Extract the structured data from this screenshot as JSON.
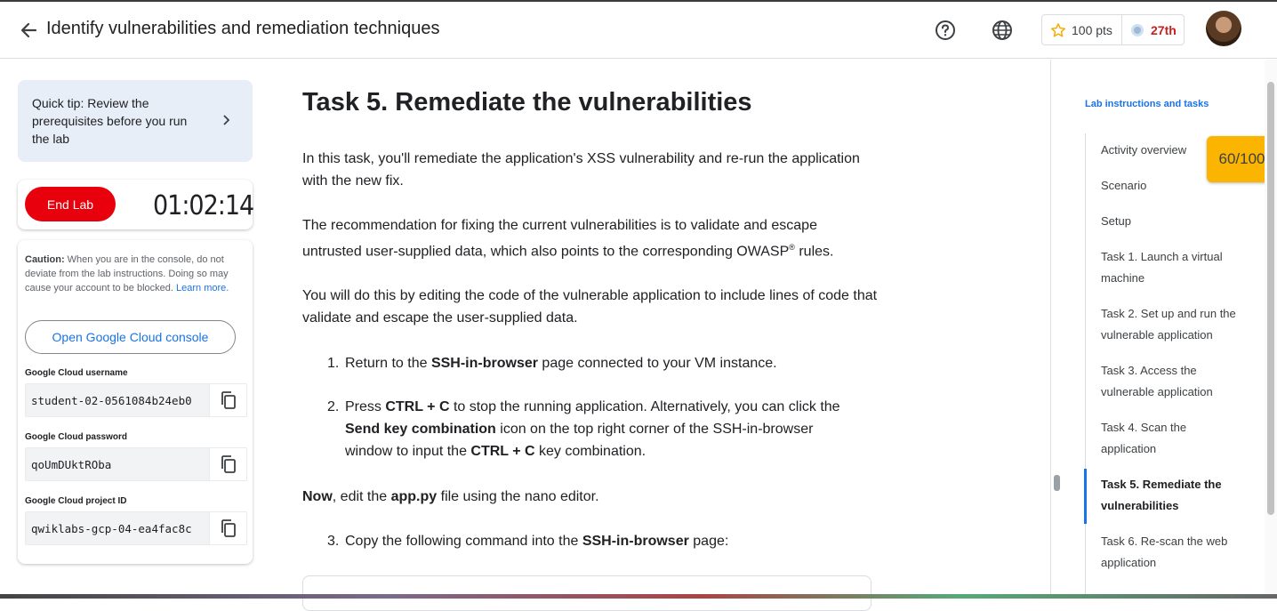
{
  "header": {
    "title": "Identify vulnerabilities and remediation techniques",
    "points": "100 pts",
    "rank": "27th"
  },
  "left": {
    "tip": "Quick tip: Review the prerequisites before you run the lab",
    "end_lab": "End Lab",
    "timer": "01:02:14",
    "caution_label": "Caution:",
    "caution_text": "When you are in the console, do not deviate from the lab instructions. Doing so may cause your account to be blocked.",
    "learn_more": "Learn more.",
    "console_button": "Open Google Cloud console",
    "credentials": [
      {
        "label": "Google Cloud username",
        "value": "student-02-0561084b24eb0"
      },
      {
        "label": "Google Cloud password",
        "value": "qoUmDUktROba"
      },
      {
        "label": "Google Cloud project ID",
        "value": "qwiklabs-gcp-04-ea4fac8c"
      }
    ]
  },
  "content": {
    "heading": "Task 5. Remediate the vulnerabilities",
    "p1": "In this task, you'll remediate the application's XSS vulnerability and re-run the application with the new fix.",
    "p2a": "The recommendation for fixing the current vulnerabilities is to validate and escape untrusted user-supplied data, which also points to the corresponding OWASP",
    "p2sup": "®",
    "p2b": " rules.",
    "p3": "You will do this by editing the code of the vulnerable application to include lines of code that validate and escape the user-supplied data.",
    "s1": {
      "num": "1.",
      "a": "Return to the ",
      "b": "SSH-in-browser",
      "c": " page connected to your VM instance."
    },
    "s2": {
      "num": "2.",
      "a": "Press ",
      "b": "CTRL + C",
      "c": " to stop the running application. Alternatively, you can click the ",
      "d": "Send key combination",
      "e": " icon on the top right corner of the SSH-in-browser window to input the ",
      "f": "CTRL + C",
      "g": " key combination."
    },
    "now": {
      "a": "Now",
      "b": ", edit the ",
      "c": "app.py",
      "d": " file using the nano editor."
    },
    "s3": {
      "num": "3.",
      "a": "Copy the following command into the ",
      "b": "SSH-in-browser",
      "c": " page:"
    }
  },
  "toc": {
    "heading": "Lab instructions and tasks",
    "score": "60/100",
    "items": [
      "Activity overview",
      "Scenario",
      "Setup",
      "Task 1. Launch a virtual machine",
      "Task 2. Set up and run the vulnerable application",
      "Task 3. Access the vulnerable application",
      "Task 4. Scan the application",
      "Task 5. Remediate the vulnerabilities",
      "Task 6. Re-scan the web application"
    ]
  },
  "colors": {
    "end_lab": "#e8000c",
    "score_badge": "#fbb400",
    "accent": "#1a73e8",
    "rank": "#c5221f"
  }
}
